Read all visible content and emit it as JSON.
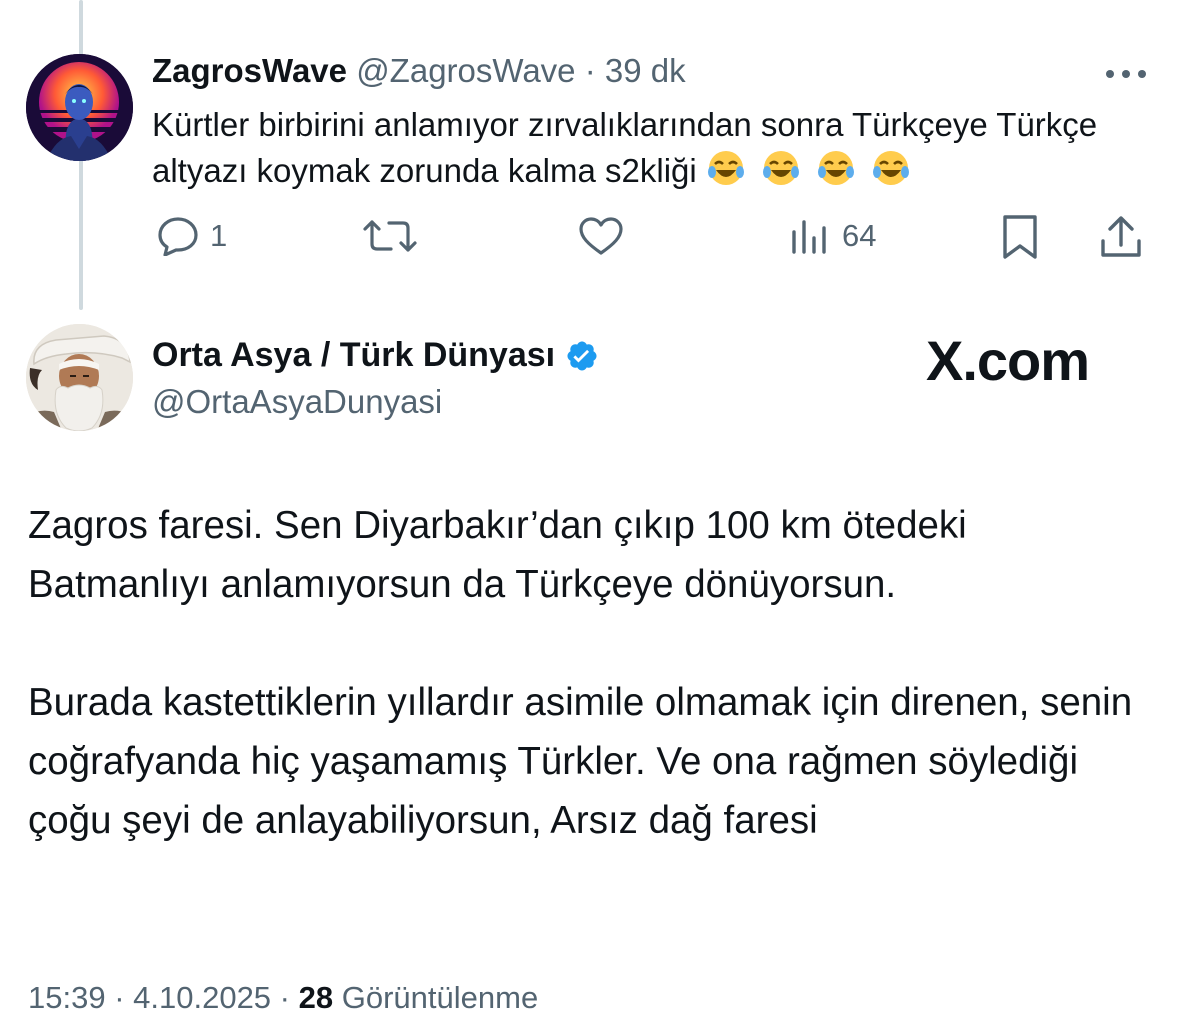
{
  "reply": {
    "display_name": "ZagrosWave",
    "handle": "@ZagrosWave",
    "separator": " · ",
    "time": "39 dk",
    "text": "Kürtler birbirini anlamıyor zırvalıklarından sonra Türkçeye Türkçe altyazı koymak zorunda kalma s2kliği",
    "emoji_count": 4,
    "emoji_icon": "face-with-tears-of-joy",
    "actions": {
      "reply_count": "1",
      "retweet_count": "",
      "like_count": "",
      "view_count": "64"
    }
  },
  "main": {
    "display_name": "Orta Asya / Türk Dünyası",
    "handle": "@OrtaAsyaDunyasi",
    "verified": true,
    "paragraph1": "Zagros faresi. Sen Diyarbakır’dan çıkıp 100 km ötedeki Batmanlıyı anlamıyorsun da Türkçeye dönüyorsun.",
    "paragraph2": "Burada kastettiklerin yıllardır asimile olmamak için direnen, senin coğrafyanda hiç yaşamamış Türkler.  Ve ona rağmen söylediği çoğu şeyi de anlayabiliyorsun, Arsız dağ faresi",
    "time": "15:39",
    "date": "4.10.2025",
    "separator": " · ",
    "view_count": "28",
    "view_label": "Görüntülenme"
  },
  "watermark": "X.com",
  "colors": {
    "text": "#0f1419",
    "secondary": "#536471",
    "verified": "#1d9bf0",
    "thread_line": "#cfd9de"
  }
}
